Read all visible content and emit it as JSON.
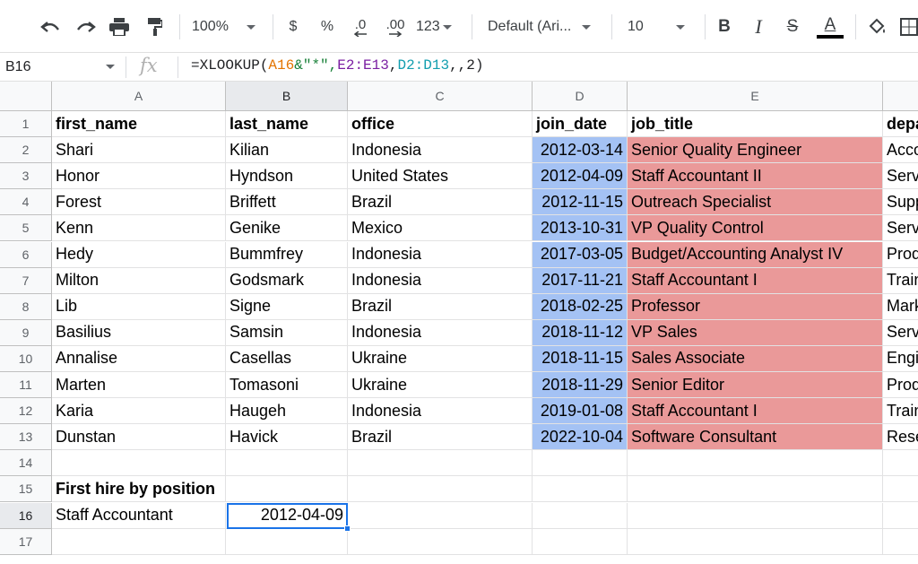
{
  "toolbar": {
    "zoom": "100%",
    "currency": "$",
    "percent": "%",
    "decimal_decrease": ".0",
    "decimal_increase": ".00",
    "more_formats": "123",
    "font_family": "Default (Ari...",
    "font_size": "10",
    "bold": "B",
    "italic": "I",
    "strikethrough": "S",
    "text_color": "A"
  },
  "formula_bar": {
    "name_box": "B16",
    "fx": "fx",
    "formula_parts": [
      "=XLOOKUP(",
      "A16",
      "&\"*\",",
      "E2:E13",
      ",",
      "D2:D13",
      ",,2)"
    ]
  },
  "columns": [
    "A",
    "B",
    "C",
    "D",
    "E"
  ],
  "row_numbers": [
    "1",
    "2",
    "3",
    "4",
    "5",
    "6",
    "7",
    "8",
    "9",
    "10",
    "11",
    "12",
    "13",
    "14",
    "15",
    "16",
    "17"
  ],
  "headers": [
    "first_name",
    "last_name",
    "office",
    "join_date",
    "job_title",
    "depa"
  ],
  "rows": [
    [
      "Shari",
      "Kilian",
      "Indonesia",
      "2012-03-14",
      "Senior Quality Engineer",
      "Acco"
    ],
    [
      "Honor",
      "Hyndson",
      "United States",
      "2012-04-09",
      "Staff Accountant II",
      "Serv"
    ],
    [
      "Forest",
      "Briffett",
      "Brazil",
      "2012-11-15",
      "Outreach Specialist",
      "Supp"
    ],
    [
      "Kenn",
      "Genike",
      "Mexico",
      "2013-10-31",
      "VP Quality Control",
      "Serv"
    ],
    [
      "Hedy",
      "Bummfrey",
      "Indonesia",
      "2017-03-05",
      "Budget/Accounting Analyst IV",
      "Prod"
    ],
    [
      "Milton",
      "Godsmark",
      "Indonesia",
      "2017-11-21",
      "Staff Accountant I",
      "Train"
    ],
    [
      "Lib",
      "Signe",
      "Brazil",
      "2018-02-25",
      "Professor",
      "Mark"
    ],
    [
      "Basilius",
      "Samsin",
      "Indonesia",
      "2018-11-12",
      "VP Sales",
      "Serv"
    ],
    [
      "Annalise",
      "Casellas",
      "Ukraine",
      "2018-11-15",
      "Sales Associate",
      "Engi"
    ],
    [
      "Marten",
      "Tomasoni",
      "Ukraine",
      "2018-11-29",
      "Senior Editor",
      "Prod"
    ],
    [
      "Karia",
      "Haugeh",
      "Indonesia",
      "2019-01-08",
      "Staff Accountant I",
      "Train"
    ],
    [
      "Dunstan",
      "Havick",
      "Brazil",
      "2022-10-04",
      "Software Consultant",
      "Rese"
    ]
  ],
  "lookup": {
    "label": "First hire by position",
    "position": "Staff Accountant",
    "result": "2012-04-09"
  },
  "colors": {
    "join_date_fill": "#a4c2f4",
    "job_title_fill": "#ea9999",
    "selection": "#1a73e8"
  }
}
